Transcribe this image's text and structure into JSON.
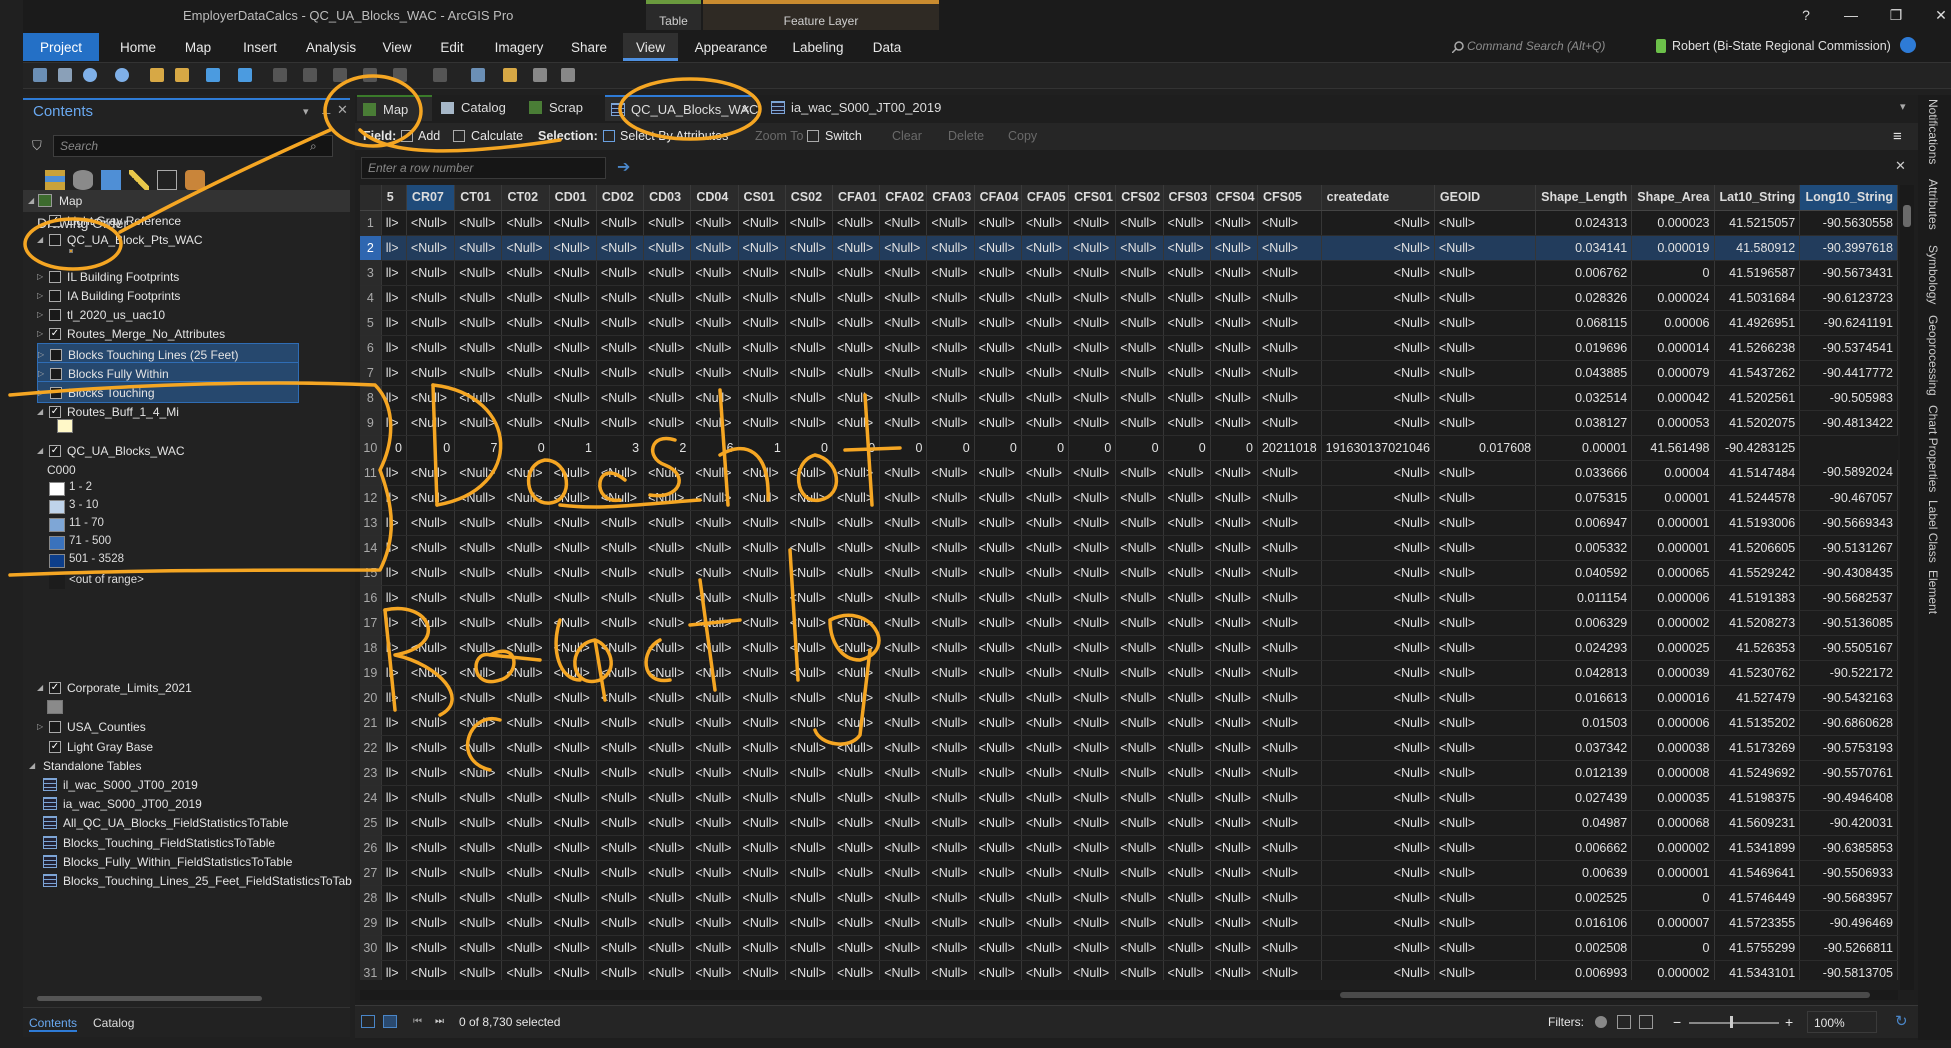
{
  "window": {
    "title": "EmployerDataCalcs - QC_UA_Blocks_WAC - ArcGIS Pro",
    "controls": [
      "?",
      "—",
      "❐",
      "✕"
    ]
  },
  "ribbon": {
    "contextual_groups": [
      "Table",
      "Feature Layer"
    ],
    "tabs": [
      "Project",
      "Home",
      "Map",
      "Insert",
      "Analysis",
      "View",
      "Edit",
      "Imagery",
      "Share",
      "View",
      "Appearance",
      "Labeling",
      "Data"
    ],
    "command_search_placeholder": "Command Search (Alt+Q)",
    "user": "Robert (Bi-State Regional Commission)"
  },
  "contents": {
    "title": "Contents",
    "search_placeholder": "Search",
    "drawing_order": "Drawing Order",
    "map_node": "Map",
    "layers": [
      {
        "label": "Light Gray Reference",
        "checked": true
      },
      {
        "label": "QC_UA_Block_Pts_WAC",
        "checked": false
      },
      {
        "label": "IL Building Footprints",
        "checked": false
      },
      {
        "label": "IA Building Footprints",
        "checked": false
      },
      {
        "label": "tl_2020_us_uac10",
        "checked": false
      },
      {
        "label": "Routes_Merge_No_Attributes",
        "checked": true
      },
      {
        "label": "Blocks Touching Lines (25 Feet)",
        "checked": false
      },
      {
        "label": "Blocks Fully Within",
        "checked": false
      },
      {
        "label": "Blocks Touching",
        "checked": false
      },
      {
        "label": "Routes_Buff_1_4_Mi",
        "checked": true
      },
      {
        "label": "QC_UA_Blocks_WAC",
        "checked": true
      }
    ],
    "legend_field": "C000",
    "legend": [
      {
        "label": "1 - 2",
        "color": "#ffffff"
      },
      {
        "label": "3 - 10",
        "color": "#bfd3ea"
      },
      {
        "label": "11 - 70",
        "color": "#7ea6d6"
      },
      {
        "label": "71 - 500",
        "color": "#3a72bc"
      },
      {
        "label": "501 - 3528",
        "color": "#0d3e8a"
      },
      {
        "label": "<out of range>",
        "color": "#1c1c1c"
      }
    ],
    "layers2": [
      {
        "label": "Corporate_Limits_2021",
        "checked": true
      },
      {
        "label": "USA_Counties",
        "checked": false
      },
      {
        "label": "Light Gray Base",
        "checked": true
      }
    ],
    "standalone_title": "Standalone Tables",
    "standalone": [
      "il_wac_S000_JT00_2019",
      "ia_wac_S000_JT00_2019",
      "All_QC_UA_Blocks_FieldStatisticsToTable",
      "Blocks_Touching_FieldStatisticsToTable",
      "Blocks_Fully_Within_FieldStatisticsToTable",
      "Blocks_Touching_Lines_25_Feet_FieldStatisticsToTab"
    ],
    "bottom_tabs": [
      "Contents",
      "Catalog"
    ]
  },
  "views": {
    "tabs": [
      "Map",
      "Catalog",
      "Scrap",
      "QC_UA_Blocks_WAC",
      "ia_wac_S000_JT00_2019"
    ]
  },
  "table_toolbar": {
    "field_label": "Field:",
    "add": "Add",
    "calculate": "Calculate",
    "selection_label": "Selection:",
    "select_by_attributes": "Select By Attributes",
    "zoom_to": "Zoom To",
    "switch": "Switch",
    "clear": "Clear",
    "delete": "Delete",
    "copy": "Copy",
    "row_placeholder": "Enter a row number"
  },
  "table": {
    "columns": [
      "5",
      "CR07",
      "CT01",
      "CT02",
      "CD01",
      "CD02",
      "CD03",
      "CD04",
      "CS01",
      "CS02",
      "CFA01",
      "CFA02",
      "CFA03",
      "CFA04",
      "CFA05",
      "CFS01",
      "CFS02",
      "CFS03",
      "CFS04",
      "CFS05",
      "createdate",
      "GEOID",
      "Shape_Length",
      "Shape_Area",
      "Lat10_String",
      "Long10_String"
    ],
    "null_label": "<Null>",
    "trunc_label": "ll>",
    "rows": [
      {
        "n": "1",
        "len": "0.024313",
        "area": "0.000023",
        "lat": "41.5215057",
        "lon": "-90.5630558"
      },
      {
        "n": "2",
        "len": "0.034141",
        "area": "0.000019",
        "lat": "41.580912",
        "lon": "-90.3997618"
      },
      {
        "n": "3",
        "len": "0.006762",
        "area": "0",
        "lat": "41.5196587",
        "lon": "-90.5673431"
      },
      {
        "n": "4",
        "len": "0.028326",
        "area": "0.000024",
        "lat": "41.5031684",
        "lon": "-90.6123723"
      },
      {
        "n": "5",
        "len": "0.068115",
        "area": "0.00006",
        "lat": "41.4926951",
        "lon": "-90.6241191"
      },
      {
        "n": "6",
        "len": "0.019696",
        "area": "0.000014",
        "lat": "41.5266238",
        "lon": "-90.5374541"
      },
      {
        "n": "7",
        "len": "0.043885",
        "area": "0.000079",
        "lat": "41.5437262",
        "lon": "-90.4417772"
      },
      {
        "n": "8",
        "len": "0.032514",
        "area": "0.000042",
        "lat": "41.5202561",
        "lon": "-90.505983"
      },
      {
        "n": "9",
        "len": "0.038127",
        "area": "0.000053",
        "lat": "41.5202075",
        "lon": "-90.4813422"
      },
      {
        "n": "10",
        "len": "0.017608",
        "area": "0.00001",
        "lat": "41.561498",
        "lon": "-90.4283125",
        "special": true
      },
      {
        "n": "11",
        "len": "0.033666",
        "area": "0.00004",
        "lat": "41.5147484",
        "lon": "-90.5892024"
      },
      {
        "n": "12",
        "len": "0.075315",
        "area": "0.00001",
        "lat": "41.5244578",
        "lon": "-90.467057"
      },
      {
        "n": "13",
        "len": "0.006947",
        "area": "0.000001",
        "lat": "41.5193006",
        "lon": "-90.5669343"
      },
      {
        "n": "14",
        "len": "0.005332",
        "area": "0.000001",
        "lat": "41.5206605",
        "lon": "-90.5131267"
      },
      {
        "n": "15",
        "len": "0.040592",
        "area": "0.000065",
        "lat": "41.5529242",
        "lon": "-90.4308435"
      },
      {
        "n": "16",
        "len": "0.011154",
        "area": "0.000006",
        "lat": "41.5191383",
        "lon": "-90.5682537"
      },
      {
        "n": "17",
        "len": "0.006329",
        "area": "0.000002",
        "lat": "41.5208273",
        "lon": "-90.5136085"
      },
      {
        "n": "18",
        "len": "0.024293",
        "area": "0.000025",
        "lat": "41.526353",
        "lon": "-90.5505167"
      },
      {
        "n": "19",
        "len": "0.042813",
        "area": "0.000039",
        "lat": "41.5230762",
        "lon": "-90.522172"
      },
      {
        "n": "20",
        "len": "0.016613",
        "area": "0.000016",
        "lat": "41.527479",
        "lon": "-90.5432163"
      },
      {
        "n": "21",
        "len": "0.01503",
        "area": "0.000006",
        "lat": "41.5135202",
        "lon": "-90.6860628"
      },
      {
        "n": "22",
        "len": "0.037342",
        "area": "0.000038",
        "lat": "41.5173269",
        "lon": "-90.5753193"
      },
      {
        "n": "23",
        "len": "0.012139",
        "area": "0.000008",
        "lat": "41.5249692",
        "lon": "-90.5570761"
      },
      {
        "n": "24",
        "len": "0.027439",
        "area": "0.000035",
        "lat": "41.5198375",
        "lon": "-90.4946408"
      },
      {
        "n": "25",
        "len": "0.04987",
        "area": "0.000068",
        "lat": "41.5609231",
        "lon": "-90.420031"
      },
      {
        "n": "26",
        "len": "0.006662",
        "area": "0.000002",
        "lat": "41.5341899",
        "lon": "-90.6385853"
      },
      {
        "n": "27",
        "len": "0.00639",
        "area": "0.000001",
        "lat": "41.5469641",
        "lon": "-90.5506933"
      },
      {
        "n": "28",
        "len": "0.002525",
        "area": "0",
        "lat": "41.5746449",
        "lon": "-90.5683957"
      },
      {
        "n": "29",
        "len": "0.016106",
        "area": "0.000007",
        "lat": "41.5723355",
        "lon": "-90.496469"
      },
      {
        "n": "30",
        "len": "0.002508",
        "area": "0",
        "lat": "41.5755299",
        "lon": "-90.5266811"
      },
      {
        "n": "31",
        "len": "0.006993",
        "area": "0.000002",
        "lat": "41.5343101",
        "lon": "-90.5813705"
      }
    ],
    "row10_values": [
      "0",
      "0",
      "7",
      "0",
      "1",
      "3",
      "2",
      "6",
      "1",
      "0",
      "0",
      "0",
      "0",
      "0",
      "0",
      "0",
      "0",
      "0",
      "0"
    ],
    "row10_createdate": "20211018",
    "row10_geoid": "191630137021046"
  },
  "status": {
    "selected": "0 of 8,730 selected",
    "filters": "Filters:",
    "zoom": "100%"
  },
  "right_panels": [
    "Notifications",
    "Attributes",
    "Symbology",
    "Geoprocessing",
    "Chart Properties",
    "Label Class",
    "Element"
  ],
  "annotation": {
    "text": "Doesn't react to Ctrl-G",
    "color": "#f5a623"
  }
}
